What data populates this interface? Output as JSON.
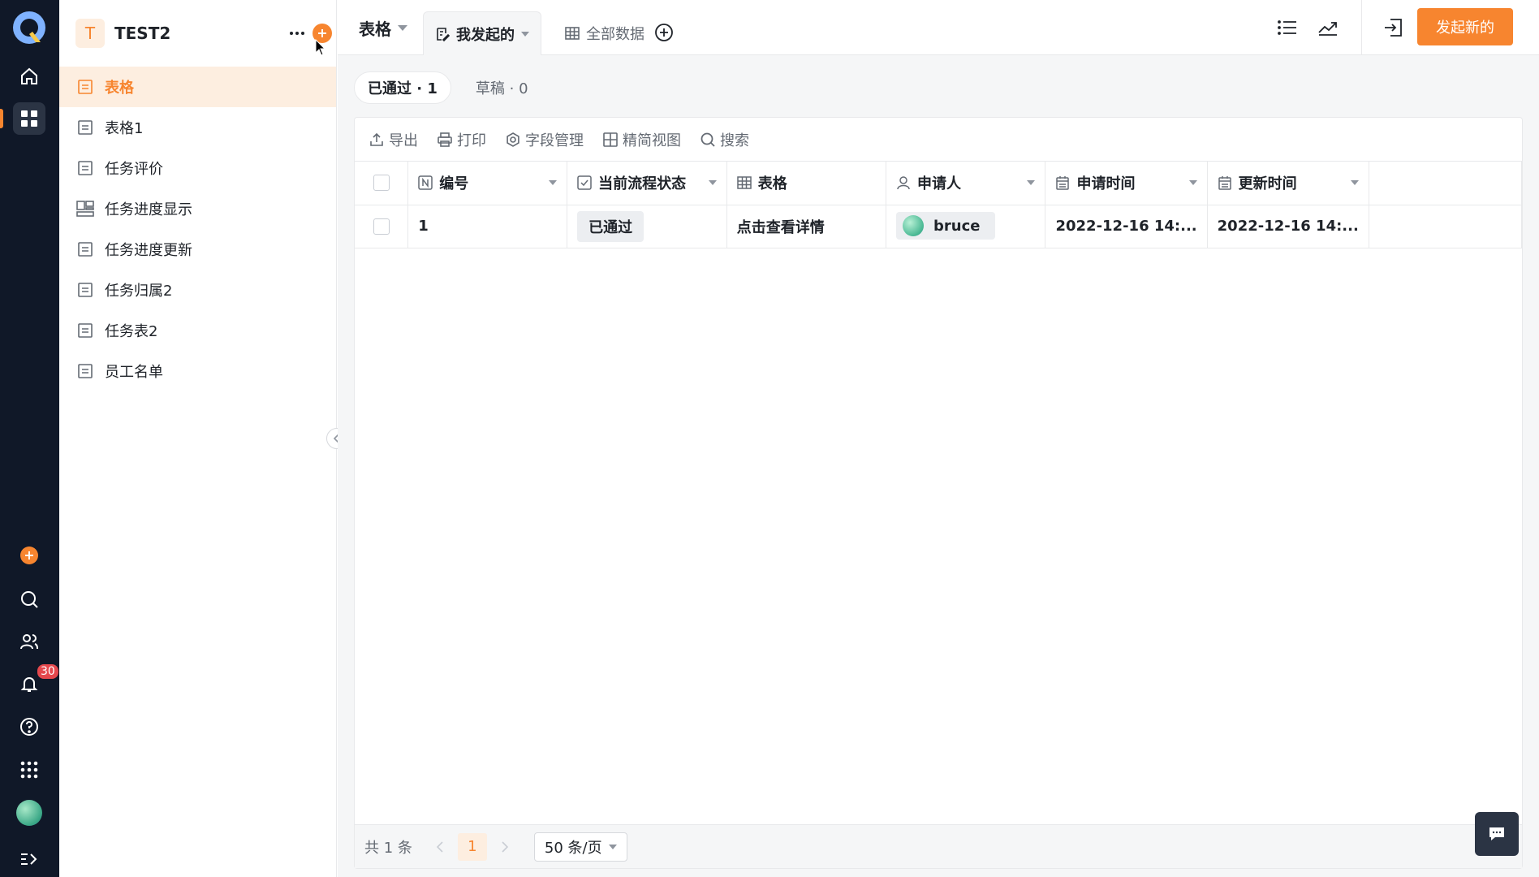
{
  "workspace": {
    "initial": "T",
    "name": "TEST2"
  },
  "sidebar": {
    "items": [
      {
        "label": "表格",
        "icon": "form-icon",
        "active": true
      },
      {
        "label": "表格1",
        "icon": "form-icon"
      },
      {
        "label": "任务评价",
        "icon": "form-icon"
      },
      {
        "label": "任务进度显示",
        "icon": "dashboard-icon"
      },
      {
        "label": "任务进度更新",
        "icon": "form-icon"
      },
      {
        "label": "任务归属2",
        "icon": "form-icon"
      },
      {
        "label": "任务表2",
        "icon": "form-icon"
      },
      {
        "label": "员工名单",
        "icon": "form-icon"
      }
    ]
  },
  "rail": {
    "notification_count": "30"
  },
  "topbar": {
    "primary_tab": "表格",
    "view_tab": "我发起的",
    "view_tab2": "全部数据",
    "launch_button": "发起新的"
  },
  "status_tabs": {
    "approved": "已通过 · 1",
    "draft": "草稿 · 0"
  },
  "toolbar": {
    "export": "导出",
    "print": "打印",
    "fields": "字段管理",
    "compact_view": "精简视图",
    "search": "搜索"
  },
  "table": {
    "headers": {
      "id": "编号",
      "status": "当前流程状态",
      "form": "表格",
      "applicant": "申请人",
      "apply_time": "申请时间",
      "update_time": "更新时间"
    },
    "rows": [
      {
        "id": "1",
        "status": "已通过",
        "form": "点击查看详情",
        "applicant": "bruce",
        "apply_time": "2022-12-16 14:...",
        "update_time": "2022-12-16 14:..."
      }
    ]
  },
  "footer": {
    "total": "共 1 条",
    "page": "1",
    "page_size": "50 条/页"
  },
  "colors": {
    "accent": "#f7852f",
    "rail_bg": "#101828",
    "accent_soft": "#fdeee0"
  }
}
